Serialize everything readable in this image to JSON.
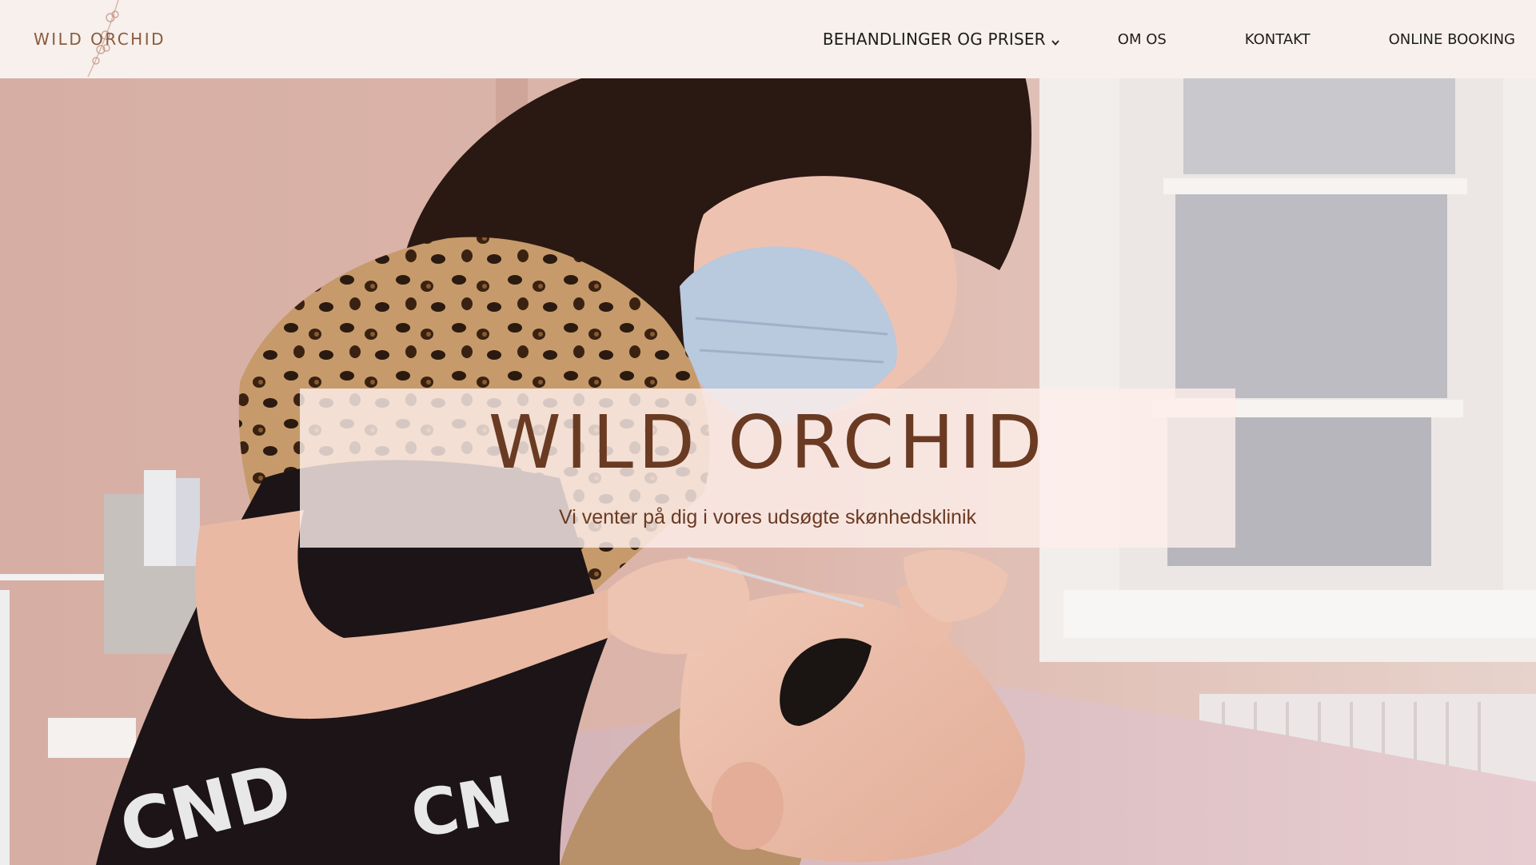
{
  "header": {
    "logo_text": "WILD ORCHID",
    "nav": [
      {
        "label": "BEHANDLINGER OG PRISER",
        "has_dropdown": true
      },
      {
        "label": "OM OS"
      },
      {
        "label": "KONTAKT"
      },
      {
        "label": "ONLINE BOOKING"
      }
    ]
  },
  "hero": {
    "title": "WILD ORCHID",
    "subtitle": "Vi venter på dig i vores udsøgte skønhedsklinik"
  },
  "colors": {
    "header_bg": "#f7f0ec",
    "brand_brown": "#6a3a22",
    "logo_brown": "#8a5a3e",
    "nav_text": "#1d1d1d",
    "overlay_bg": "#fceeea"
  },
  "icons": {
    "logo_graphic": "orchid-branch-icon",
    "dropdown": "chevron-down-icon"
  }
}
